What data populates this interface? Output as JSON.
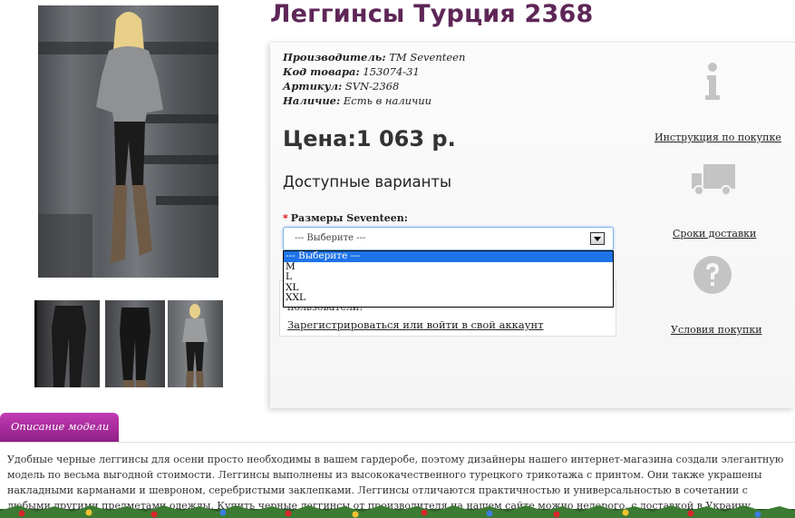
{
  "product": {
    "title": "Леггинсы Турция 2368"
  },
  "specs": [
    {
      "key": "Производитель:",
      "value": "ТМ Seventeen"
    },
    {
      "key": "Код товара:",
      "value": "153074-31"
    },
    {
      "key": "Артикул:",
      "value": "SVN-2368"
    },
    {
      "key": "Наличие:",
      "value": "Есть в наличии"
    }
  ],
  "price": "Цена:1 063 р.",
  "variants": {
    "heading": "Доступные варианты",
    "size_label": "Размеры Seventeen:",
    "required_mark": "*",
    "selected": "--- Выберите ---",
    "options": [
      "--- Выберите ---",
      "M",
      "L",
      "XL",
      "XXL"
    ]
  },
  "notice": {
    "text": "пользователи!",
    "link": "Зарегистрироваться или войти в свой аккаунт"
  },
  "aside": {
    "instructions": "Инструкция по покупке",
    "delivery": "Сроки доставки",
    "terms": "Условия покупки"
  },
  "description": {
    "tab_label": "Описание модели",
    "text": "Удобные черные леггинсы для осени просто необходимы в вашем гардеробе, поэтому дизайнеры нашего интернет-магазина создали элегантную модель по весьма выгодной стоимости. Леггинсы выполнены из высококачественного турецкого трикотажа с принтом. Они также украшены накладными карманами и шевроном, серебристыми заклепками. Леггинсы отличаются практичностью и универсальностью в сочетании с любыми другими предметами одежды. Купить черные леггинсы от производителя на нашем сайте можно недорого, с доставкой в Украину, Россию и в другие страны. Для этого всего лишь нужно оформить"
  },
  "icons": {
    "info": "info-icon",
    "truck": "truck-icon",
    "question": "question-icon"
  }
}
